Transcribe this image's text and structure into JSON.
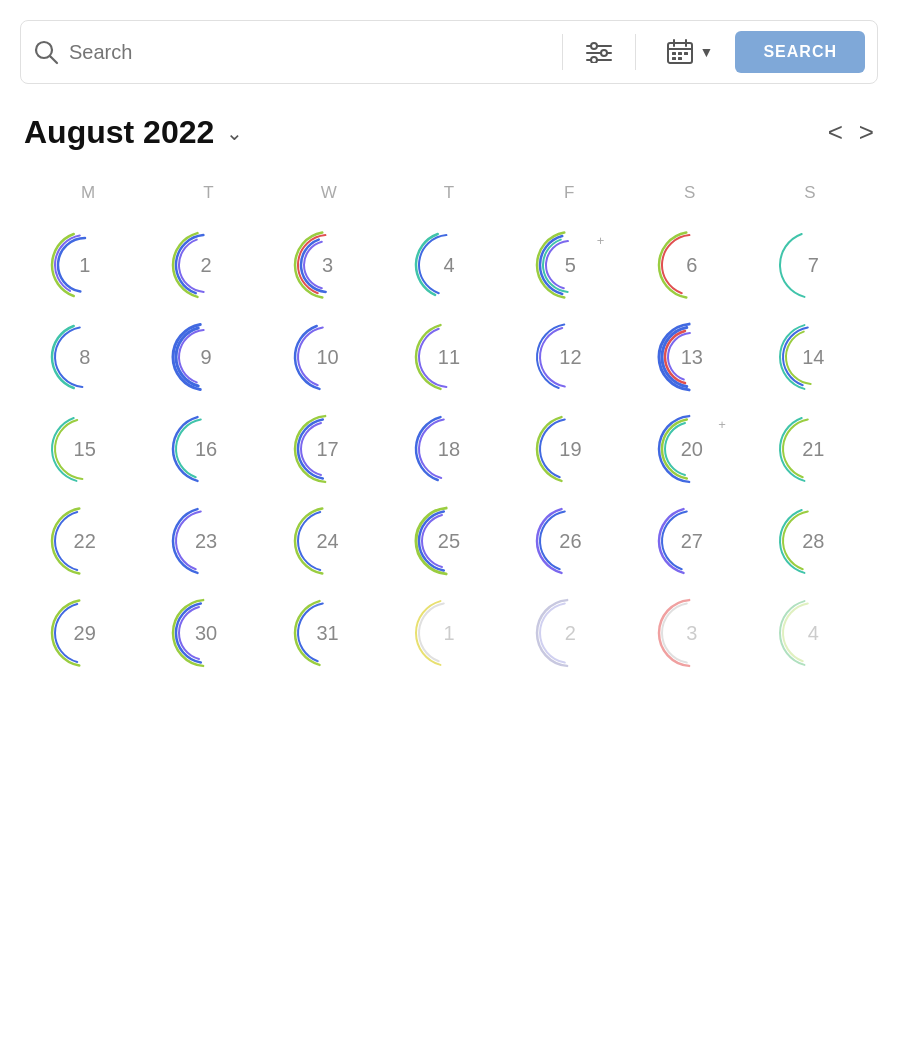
{
  "searchbar": {
    "placeholder": "Search",
    "search_button_label": "SEARCH",
    "search_button_color": "#7fa8d8"
  },
  "calendar": {
    "title": "August 2022",
    "nav_prev": "<",
    "nav_next": ">",
    "day_headers": [
      "M",
      "T",
      "W",
      "T",
      "F",
      "S",
      "S"
    ],
    "days": [
      {
        "num": "1",
        "faded": false,
        "arcs": [
          {
            "r": 33,
            "startDeg": 200,
            "endDeg": 340,
            "color": "#9acd40",
            "sw": 2.5
          },
          {
            "r": 30,
            "startDeg": 210,
            "endDeg": 350,
            "color": "#7b68ee",
            "sw": 2
          },
          {
            "r": 27,
            "startDeg": 190,
            "endDeg": 360,
            "color": "#4169e1",
            "sw": 2.5
          }
        ]
      },
      {
        "num": "2",
        "faded": false,
        "arcs": [
          {
            "r": 33,
            "startDeg": 195,
            "endDeg": 345,
            "color": "#9acd40",
            "sw": 2.5
          },
          {
            "r": 30,
            "startDeg": 200,
            "endDeg": 355,
            "color": "#4169e1",
            "sw": 2.5
          },
          {
            "r": 27,
            "startDeg": 185,
            "endDeg": 340,
            "color": "#7b68ee",
            "sw": 2
          }
        ]
      },
      {
        "num": "3",
        "faded": false,
        "arcs": [
          {
            "r": 33,
            "startDeg": 190,
            "endDeg": 350,
            "color": "#9acd40",
            "sw": 2.5
          },
          {
            "r": 30,
            "startDeg": 200,
            "endDeg": 355,
            "color": "#e05050",
            "sw": 2
          },
          {
            "r": 27,
            "startDeg": 185,
            "endDeg": 340,
            "color": "#4169e1",
            "sw": 2.5
          },
          {
            "r": 24,
            "startDeg": 195,
            "endDeg": 345,
            "color": "#7b68ee",
            "sw": 2
          }
        ]
      },
      {
        "num": "4",
        "faded": false,
        "arcs": [
          {
            "r": 33,
            "startDeg": 205,
            "endDeg": 340,
            "color": "#40c4aa",
            "sw": 2.5
          },
          {
            "r": 30,
            "startDeg": 200,
            "endDeg": 355,
            "color": "#4169e1",
            "sw": 2
          }
        ]
      },
      {
        "num": "5",
        "faded": false,
        "plus": true,
        "arcs": [
          {
            "r": 33,
            "startDeg": 190,
            "endDeg": 350,
            "color": "#9acd40",
            "sw": 2.5
          },
          {
            "r": 30,
            "startDeg": 195,
            "endDeg": 345,
            "color": "#4169e1",
            "sw": 2.5
          },
          {
            "r": 27,
            "startDeg": 185,
            "endDeg": 340,
            "color": "#40c4aa",
            "sw": 2
          },
          {
            "r": 24,
            "startDeg": 195,
            "endDeg": 355,
            "color": "#7b68ee",
            "sw": 2
          }
        ]
      },
      {
        "num": "6",
        "faded": false,
        "arcs": [
          {
            "r": 33,
            "startDeg": 190,
            "endDeg": 350,
            "color": "#9acd40",
            "sw": 2.5
          },
          {
            "r": 30,
            "startDeg": 200,
            "endDeg": 355,
            "color": "#e05050",
            "sw": 2
          }
        ]
      },
      {
        "num": "7",
        "faded": false,
        "arcs": [
          {
            "r": 33,
            "startDeg": 195,
            "endDeg": 340,
            "color": "#40c4aa",
            "sw": 2
          }
        ]
      },
      {
        "num": "8",
        "faded": false,
        "arcs": [
          {
            "r": 33,
            "startDeg": 200,
            "endDeg": 340,
            "color": "#40c4aa",
            "sw": 2.5
          },
          {
            "r": 30,
            "startDeg": 185,
            "endDeg": 350,
            "color": "#4169e1",
            "sw": 2
          }
        ]
      },
      {
        "num": "9",
        "faded": false,
        "arcs": [
          {
            "r": 33,
            "startDeg": 190,
            "endDeg": 350,
            "color": "#4169e1",
            "sw": 3
          },
          {
            "r": 30,
            "startDeg": 195,
            "endDeg": 345,
            "color": "#4169e1",
            "sw": 3
          },
          {
            "r": 27,
            "startDeg": 200,
            "endDeg": 355,
            "color": "#7b68ee",
            "sw": 2
          }
        ]
      },
      {
        "num": "10",
        "faded": false,
        "arcs": [
          {
            "r": 33,
            "startDeg": 195,
            "endDeg": 340,
            "color": "#4169e1",
            "sw": 2.5
          },
          {
            "r": 30,
            "startDeg": 200,
            "endDeg": 350,
            "color": "#7b68ee",
            "sw": 2
          }
        ]
      },
      {
        "num": "11",
        "faded": false,
        "arcs": [
          {
            "r": 33,
            "startDeg": 195,
            "endDeg": 345,
            "color": "#9acd40",
            "sw": 2.5
          },
          {
            "r": 30,
            "startDeg": 185,
            "endDeg": 340,
            "color": "#7b68ee",
            "sw": 2
          }
        ]
      },
      {
        "num": "12",
        "faded": false,
        "arcs": [
          {
            "r": 33,
            "startDeg": 200,
            "endDeg": 350,
            "color": "#4169e1",
            "sw": 2
          },
          {
            "r": 30,
            "startDeg": 190,
            "endDeg": 345,
            "color": "#7b68ee",
            "sw": 2
          }
        ]
      },
      {
        "num": "13",
        "faded": false,
        "arcs": [
          {
            "r": 33,
            "startDeg": 185,
            "endDeg": 355,
            "color": "#4169e1",
            "sw": 3
          },
          {
            "r": 30,
            "startDeg": 190,
            "endDeg": 350,
            "color": "#4169e1",
            "sw": 3
          },
          {
            "r": 27,
            "startDeg": 195,
            "endDeg": 345,
            "color": "#e05050",
            "sw": 2.5
          },
          {
            "r": 24,
            "startDeg": 200,
            "endDeg": 355,
            "color": "#7b68ee",
            "sw": 2
          }
        ]
      },
      {
        "num": "14",
        "faded": false,
        "arcs": [
          {
            "r": 33,
            "startDeg": 195,
            "endDeg": 345,
            "color": "#40c4aa",
            "sw": 2
          },
          {
            "r": 30,
            "startDeg": 200,
            "endDeg": 350,
            "color": "#4169e1",
            "sw": 2
          },
          {
            "r": 27,
            "startDeg": 185,
            "endDeg": 340,
            "color": "#9acd40",
            "sw": 2
          }
        ]
      },
      {
        "num": "15",
        "faded": false,
        "arcs": [
          {
            "r": 33,
            "startDeg": 195,
            "endDeg": 340,
            "color": "#40c4aa",
            "sw": 2
          },
          {
            "r": 30,
            "startDeg": 185,
            "endDeg": 345,
            "color": "#9acd40",
            "sw": 2
          }
        ]
      },
      {
        "num": "16",
        "faded": false,
        "arcs": [
          {
            "r": 33,
            "startDeg": 195,
            "endDeg": 345,
            "color": "#4169e1",
            "sw": 2.5
          },
          {
            "r": 30,
            "startDeg": 200,
            "endDeg": 350,
            "color": "#40c4aa",
            "sw": 2
          }
        ]
      },
      {
        "num": "17",
        "faded": false,
        "arcs": [
          {
            "r": 33,
            "startDeg": 185,
            "endDeg": 355,
            "color": "#9acd40",
            "sw": 2.5
          },
          {
            "r": 30,
            "startDeg": 190,
            "endDeg": 350,
            "color": "#4169e1",
            "sw": 2.5
          },
          {
            "r": 27,
            "startDeg": 195,
            "endDeg": 345,
            "color": "#7b68ee",
            "sw": 2
          }
        ]
      },
      {
        "num": "18",
        "faded": false,
        "arcs": [
          {
            "r": 33,
            "startDeg": 200,
            "endDeg": 345,
            "color": "#4169e1",
            "sw": 2.5
          },
          {
            "r": 30,
            "startDeg": 195,
            "endDeg": 350,
            "color": "#7b68ee",
            "sw": 2
          }
        ]
      },
      {
        "num": "19",
        "faded": false,
        "arcs": [
          {
            "r": 33,
            "startDeg": 195,
            "endDeg": 345,
            "color": "#9acd40",
            "sw": 2.5
          },
          {
            "r": 30,
            "startDeg": 200,
            "endDeg": 350,
            "color": "#4169e1",
            "sw": 2
          }
        ]
      },
      {
        "num": "20",
        "faded": false,
        "plus": true,
        "arcs": [
          {
            "r": 33,
            "startDeg": 185,
            "endDeg": 355,
            "color": "#4169e1",
            "sw": 2.5
          },
          {
            "r": 30,
            "startDeg": 190,
            "endDeg": 350,
            "color": "#9acd40",
            "sw": 2.5
          },
          {
            "r": 27,
            "startDeg": 195,
            "endDeg": 345,
            "color": "#40c4aa",
            "sw": 2
          }
        ]
      },
      {
        "num": "21",
        "faded": false,
        "arcs": [
          {
            "r": 33,
            "startDeg": 195,
            "endDeg": 340,
            "color": "#40c4aa",
            "sw": 2
          },
          {
            "r": 30,
            "startDeg": 200,
            "endDeg": 350,
            "color": "#9acd40",
            "sw": 2
          }
        ]
      },
      {
        "num": "22",
        "faded": false,
        "arcs": [
          {
            "r": 33,
            "startDeg": 190,
            "endDeg": 350,
            "color": "#9acd40",
            "sw": 2.5
          },
          {
            "r": 30,
            "startDeg": 195,
            "endDeg": 345,
            "color": "#4169e1",
            "sw": 2
          }
        ]
      },
      {
        "num": "23",
        "faded": false,
        "arcs": [
          {
            "r": 33,
            "startDeg": 195,
            "endDeg": 345,
            "color": "#4169e1",
            "sw": 2.5
          },
          {
            "r": 30,
            "startDeg": 200,
            "endDeg": 350,
            "color": "#7b68ee",
            "sw": 2
          }
        ]
      },
      {
        "num": "24",
        "faded": false,
        "arcs": [
          {
            "r": 33,
            "startDeg": 190,
            "endDeg": 350,
            "color": "#9acd40",
            "sw": 2.5
          },
          {
            "r": 30,
            "startDeg": 195,
            "endDeg": 345,
            "color": "#4169e1",
            "sw": 2
          }
        ]
      },
      {
        "num": "25",
        "faded": false,
        "arcs": [
          {
            "r": 33,
            "startDeg": 185,
            "endDeg": 355,
            "color": "#9acd40",
            "sw": 3
          },
          {
            "r": 30,
            "startDeg": 190,
            "endDeg": 350,
            "color": "#4169e1",
            "sw": 2.5
          },
          {
            "r": 27,
            "startDeg": 195,
            "endDeg": 345,
            "color": "#7b68ee",
            "sw": 2
          }
        ]
      },
      {
        "num": "26",
        "faded": false,
        "arcs": [
          {
            "r": 33,
            "startDeg": 195,
            "endDeg": 345,
            "color": "#7b68ee",
            "sw": 2.5
          },
          {
            "r": 30,
            "startDeg": 200,
            "endDeg": 350,
            "color": "#4169e1",
            "sw": 2
          }
        ]
      },
      {
        "num": "27",
        "faded": false,
        "arcs": [
          {
            "r": 33,
            "startDeg": 195,
            "endDeg": 345,
            "color": "#7b68ee",
            "sw": 2.5
          },
          {
            "r": 30,
            "startDeg": 200,
            "endDeg": 350,
            "color": "#4169e1",
            "sw": 2
          }
        ]
      },
      {
        "num": "28",
        "faded": false,
        "arcs": [
          {
            "r": 33,
            "startDeg": 195,
            "endDeg": 340,
            "color": "#40c4aa",
            "sw": 2
          },
          {
            "r": 30,
            "startDeg": 200,
            "endDeg": 350,
            "color": "#9acd40",
            "sw": 2
          }
        ]
      },
      {
        "num": "29",
        "faded": false,
        "arcs": [
          {
            "r": 33,
            "startDeg": 190,
            "endDeg": 350,
            "color": "#9acd40",
            "sw": 2.5
          },
          {
            "r": 30,
            "startDeg": 195,
            "endDeg": 345,
            "color": "#4169e1",
            "sw": 2
          }
        ]
      },
      {
        "num": "30",
        "faded": false,
        "arcs": [
          {
            "r": 33,
            "startDeg": 185,
            "endDeg": 355,
            "color": "#9acd40",
            "sw": 2.5
          },
          {
            "r": 30,
            "startDeg": 190,
            "endDeg": 350,
            "color": "#4169e1",
            "sw": 2.5
          },
          {
            "r": 27,
            "startDeg": 195,
            "endDeg": 345,
            "color": "#7b68ee",
            "sw": 2
          }
        ]
      },
      {
        "num": "31",
        "faded": false,
        "arcs": [
          {
            "r": 33,
            "startDeg": 195,
            "endDeg": 345,
            "color": "#9acd40",
            "sw": 2.5
          },
          {
            "r": 30,
            "startDeg": 200,
            "endDeg": 350,
            "color": "#4169e1",
            "sw": 2
          }
        ]
      },
      {
        "num": "1",
        "faded": true,
        "arcs": [
          {
            "r": 33,
            "startDeg": 195,
            "endDeg": 345,
            "color": "#e8e070",
            "sw": 2
          },
          {
            "r": 30,
            "startDeg": 200,
            "endDeg": 350,
            "color": "#e0e0e0",
            "sw": 2
          }
        ]
      },
      {
        "num": "2",
        "faded": true,
        "arcs": [
          {
            "r": 33,
            "startDeg": 185,
            "endDeg": 355,
            "color": "#c8c8e0",
            "sw": 2.5
          },
          {
            "r": 30,
            "startDeg": 190,
            "endDeg": 350,
            "color": "#d0d0f0",
            "sw": 2
          }
        ]
      },
      {
        "num": "3",
        "faded": true,
        "arcs": [
          {
            "r": 33,
            "startDeg": 185,
            "endDeg": 355,
            "color": "#f0a0a0",
            "sw": 2.5
          },
          {
            "r": 30,
            "startDeg": 190,
            "endDeg": 350,
            "color": "#e0e0e0",
            "sw": 2
          }
        ]
      },
      {
        "num": "4",
        "faded": true,
        "arcs": [
          {
            "r": 33,
            "startDeg": 195,
            "endDeg": 345,
            "color": "#b0e0c0",
            "sw": 2
          },
          {
            "r": 30,
            "startDeg": 200,
            "endDeg": 350,
            "color": "#e0f0c0",
            "sw": 2
          }
        ]
      }
    ]
  }
}
